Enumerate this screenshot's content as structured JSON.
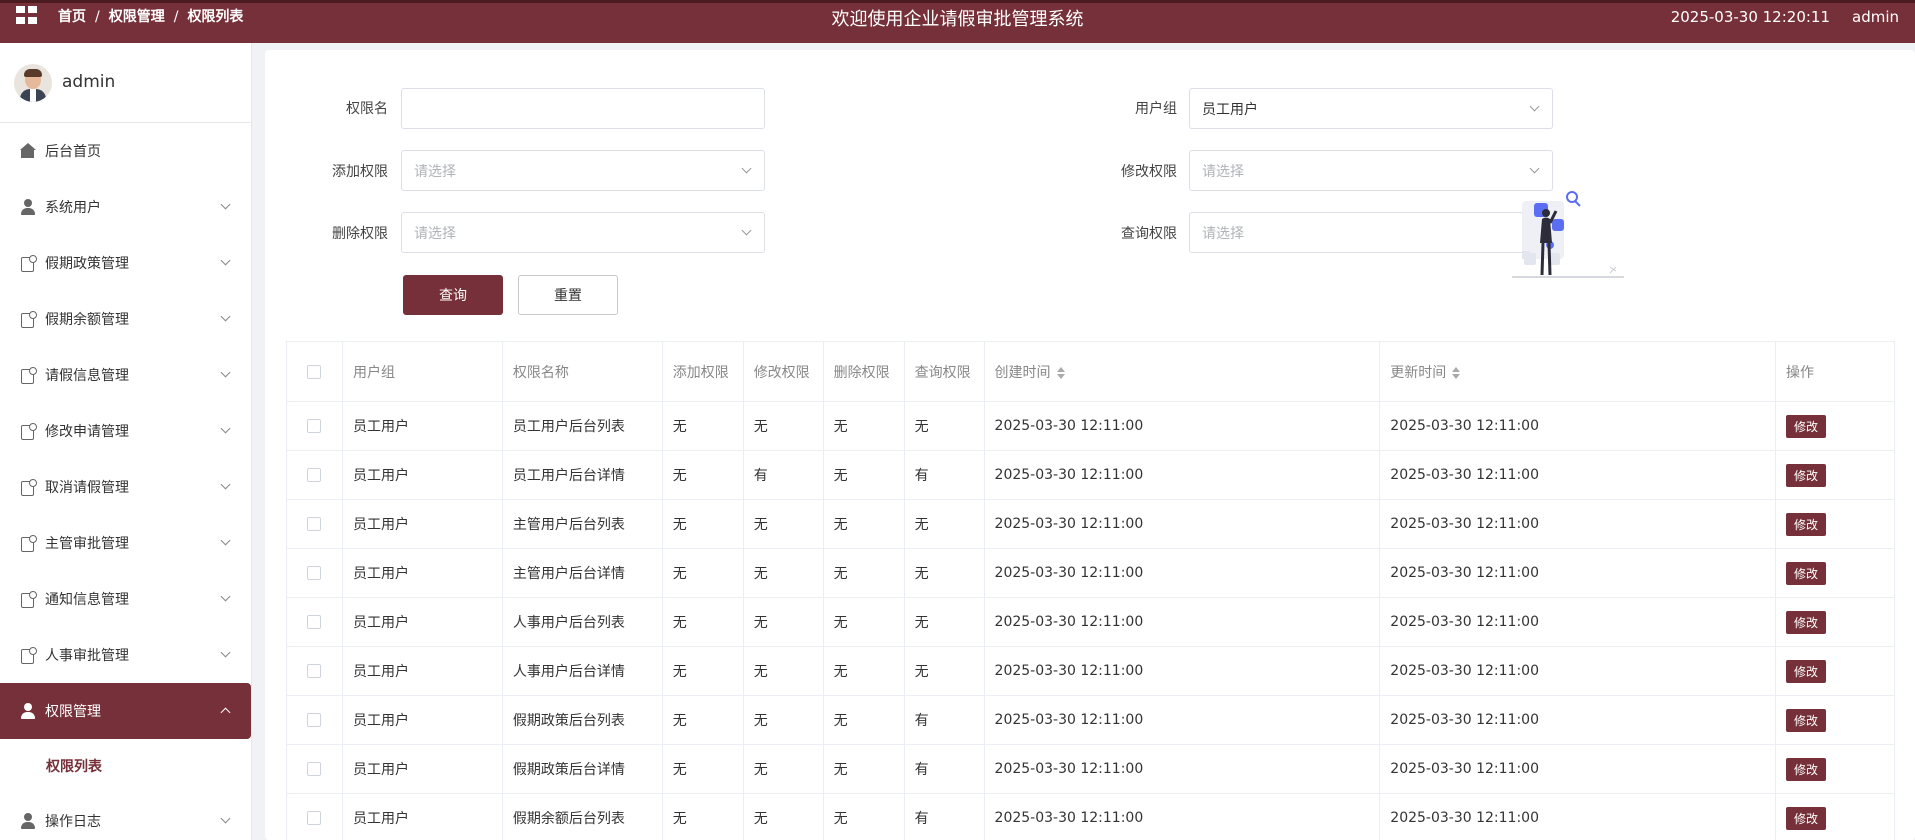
{
  "header": {
    "breadcrumb": [
      "首页",
      "权限管理",
      "权限列表"
    ],
    "title": "欢迎使用企业请假审批管理系统",
    "datetime": "2025-03-30 12:20:11",
    "user": "admin"
  },
  "sidebar": {
    "username": "admin",
    "items": [
      {
        "label": "后台首页",
        "icon": "home-icon"
      },
      {
        "label": "系统用户",
        "icon": "user-icon"
      },
      {
        "label": "假期政策管理",
        "icon": "document-icon"
      },
      {
        "label": "假期余额管理",
        "icon": "document-icon"
      },
      {
        "label": "请假信息管理",
        "icon": "document-icon"
      },
      {
        "label": "修改申请管理",
        "icon": "document-icon"
      },
      {
        "label": "取消请假管理",
        "icon": "document-icon"
      },
      {
        "label": "主管审批管理",
        "icon": "document-icon"
      },
      {
        "label": "通知信息管理",
        "icon": "document-icon"
      },
      {
        "label": "人事审批管理",
        "icon": "document-icon"
      },
      {
        "label": "权限管理",
        "icon": "user-icon"
      },
      {
        "label": "操作日志",
        "icon": "user-icon"
      }
    ],
    "sub_item": "权限列表"
  },
  "filters": {
    "perm_name_label": "权限名",
    "perm_name_value": "",
    "user_group_label": "用户组",
    "user_group_value": "员工用户",
    "add_label": "添加权限",
    "modify_label": "修改权限",
    "delete_label": "删除权限",
    "query_label": "查询权限",
    "placeholder": "请选择",
    "search_button": "查询",
    "reset_button": "重置"
  },
  "table": {
    "columns": [
      "用户组",
      "权限名称",
      "添加权限",
      "修改权限",
      "删除权限",
      "查询权限",
      "创建时间",
      "更新时间",
      "操作"
    ],
    "edit_label": "修改",
    "rows": [
      [
        "员工用户",
        "员工用户后台列表",
        "无",
        "无",
        "无",
        "无",
        "2025-03-30 12:11:00",
        "2025-03-30 12:11:00"
      ],
      [
        "员工用户",
        "员工用户后台详情",
        "无",
        "有",
        "无",
        "有",
        "2025-03-30 12:11:00",
        "2025-03-30 12:11:00"
      ],
      [
        "员工用户",
        "主管用户后台列表",
        "无",
        "无",
        "无",
        "无",
        "2025-03-30 12:11:00",
        "2025-03-30 12:11:00"
      ],
      [
        "员工用户",
        "主管用户后台详情",
        "无",
        "无",
        "无",
        "无",
        "2025-03-30 12:11:00",
        "2025-03-30 12:11:00"
      ],
      [
        "员工用户",
        "人事用户后台列表",
        "无",
        "无",
        "无",
        "无",
        "2025-03-30 12:11:00",
        "2025-03-30 12:11:00"
      ],
      [
        "员工用户",
        "人事用户后台详情",
        "无",
        "无",
        "无",
        "无",
        "2025-03-30 12:11:00",
        "2025-03-30 12:11:00"
      ],
      [
        "员工用户",
        "假期政策后台列表",
        "无",
        "无",
        "无",
        "有",
        "2025-03-30 12:11:00",
        "2025-03-30 12:11:00"
      ],
      [
        "员工用户",
        "假期政策后台详情",
        "无",
        "无",
        "无",
        "有",
        "2025-03-30 12:11:00",
        "2025-03-30 12:11:00"
      ],
      [
        "员工用户",
        "假期余额后台列表",
        "无",
        "无",
        "无",
        "有",
        "2025-03-30 12:11:00",
        "2025-03-30 12:11:00"
      ]
    ]
  },
  "colors": {
    "brand": "#76303a",
    "sidebar_bg": "#ffffff",
    "page_bg": "#f0f2f5"
  }
}
